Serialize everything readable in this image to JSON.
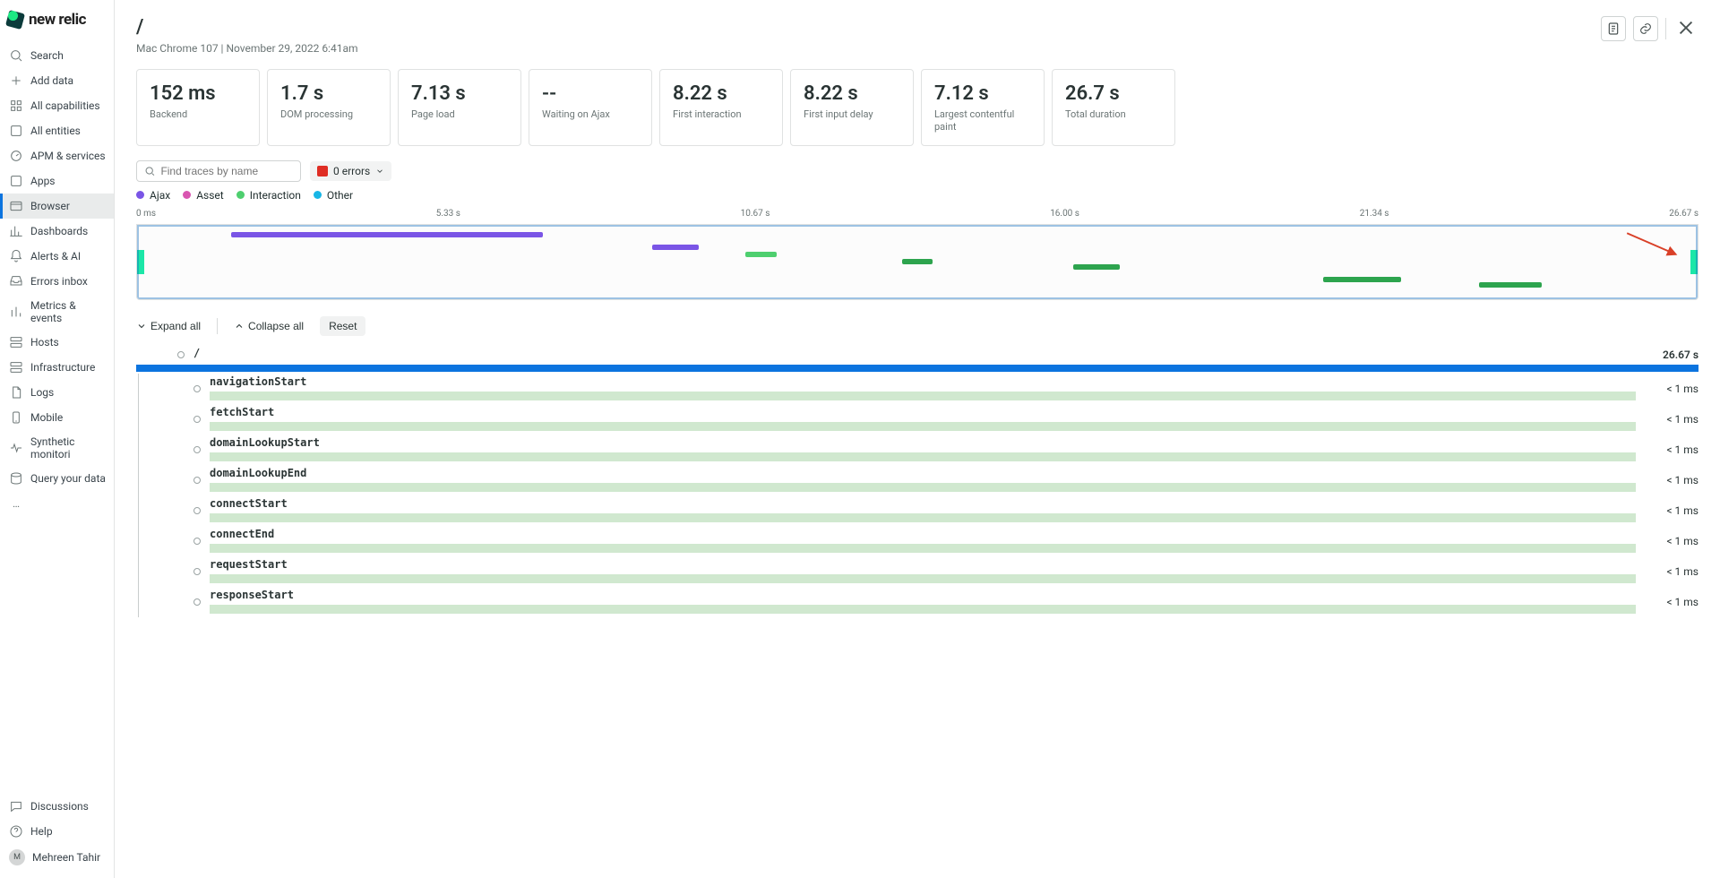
{
  "brand": {
    "wordmark": "new relic"
  },
  "sidebar": {
    "top_items": [
      {
        "name": "search",
        "label": "Search",
        "icon": "search"
      },
      {
        "name": "add-data",
        "label": "Add data",
        "icon": "plus"
      },
      {
        "name": "all-capabilities",
        "label": "All capabilities",
        "icon": "grid"
      },
      {
        "name": "all-entities",
        "label": "All entities",
        "icon": "box"
      },
      {
        "name": "apm-services",
        "label": "APM & services",
        "icon": "gauge"
      },
      {
        "name": "apps",
        "label": "Apps",
        "icon": "box"
      },
      {
        "name": "browser",
        "label": "Browser",
        "icon": "window",
        "active": true
      },
      {
        "name": "dashboards",
        "label": "Dashboards",
        "icon": "chart"
      },
      {
        "name": "alerts-ai",
        "label": "Alerts & AI",
        "icon": "bell"
      },
      {
        "name": "errors-inbox",
        "label": "Errors inbox",
        "icon": "inbox"
      },
      {
        "name": "metrics-events",
        "label": "Metrics & events",
        "icon": "bars"
      },
      {
        "name": "hosts",
        "label": "Hosts",
        "icon": "server"
      },
      {
        "name": "infrastructure",
        "label": "Infrastructure",
        "icon": "server"
      },
      {
        "name": "logs",
        "label": "Logs",
        "icon": "doc"
      },
      {
        "name": "mobile",
        "label": "Mobile",
        "icon": "mobile"
      },
      {
        "name": "synthetic",
        "label": "Synthetic monitori",
        "icon": "pulse"
      },
      {
        "name": "query",
        "label": "Query your data",
        "icon": "db"
      }
    ],
    "more_label": "…",
    "bottom_items": [
      {
        "name": "discussions",
        "label": "Discussions",
        "icon": "chat"
      },
      {
        "name": "help",
        "label": "Help",
        "icon": "help"
      }
    ],
    "user": {
      "name": "Mehreen Tahir",
      "initials": "M"
    }
  },
  "header": {
    "title": "/",
    "subtitle": "Mac Chrome 107 | November 29, 2022 6:41am"
  },
  "metrics": [
    {
      "value": "152 ms",
      "label": "Backend"
    },
    {
      "value": "1.7 s",
      "label": "DOM processing"
    },
    {
      "value": "7.13 s",
      "label": "Page load"
    },
    {
      "value": "--",
      "label": "Waiting on Ajax"
    },
    {
      "value": "8.22 s",
      "label": "First interaction"
    },
    {
      "value": "8.22 s",
      "label": "First input delay"
    },
    {
      "value": "7.12 s",
      "label": "Largest contentful paint"
    },
    {
      "value": "26.7 s",
      "label": "Total duration"
    }
  ],
  "toolbar": {
    "search_placeholder": "Find traces by name",
    "errors_label": "0 errors"
  },
  "legend": [
    {
      "label": "Ajax",
      "color": "#7a55e6"
    },
    {
      "label": "Asset",
      "color": "#d956b1"
    },
    {
      "label": "Interaction",
      "color": "#4ecf6f"
    },
    {
      "label": "Other",
      "color": "#18b6e6"
    }
  ],
  "axis": {
    "ticks": [
      "0 ms",
      "5.33 s",
      "10.67 s",
      "16.00 s",
      "21.34 s",
      "26.67 s"
    ]
  },
  "wf_controls": {
    "expand_label": "Expand all",
    "collapse_label": "Collapse all",
    "reset_label": "Reset"
  },
  "waterfall": {
    "root": {
      "name": "/",
      "duration": "26.67 s"
    },
    "events": [
      {
        "name": "navigationStart",
        "duration": "< 1 ms"
      },
      {
        "name": "fetchStart",
        "duration": "< 1 ms"
      },
      {
        "name": "domainLookupStart",
        "duration": "< 1 ms"
      },
      {
        "name": "domainLookupEnd",
        "duration": "< 1 ms"
      },
      {
        "name": "connectStart",
        "duration": "< 1 ms"
      },
      {
        "name": "connectEnd",
        "duration": "< 1 ms"
      },
      {
        "name": "requestStart",
        "duration": "< 1 ms"
      },
      {
        "name": "responseStart",
        "duration": "< 1 ms"
      }
    ]
  },
  "annotation": {
    "arrow_color": "#d94028"
  }
}
